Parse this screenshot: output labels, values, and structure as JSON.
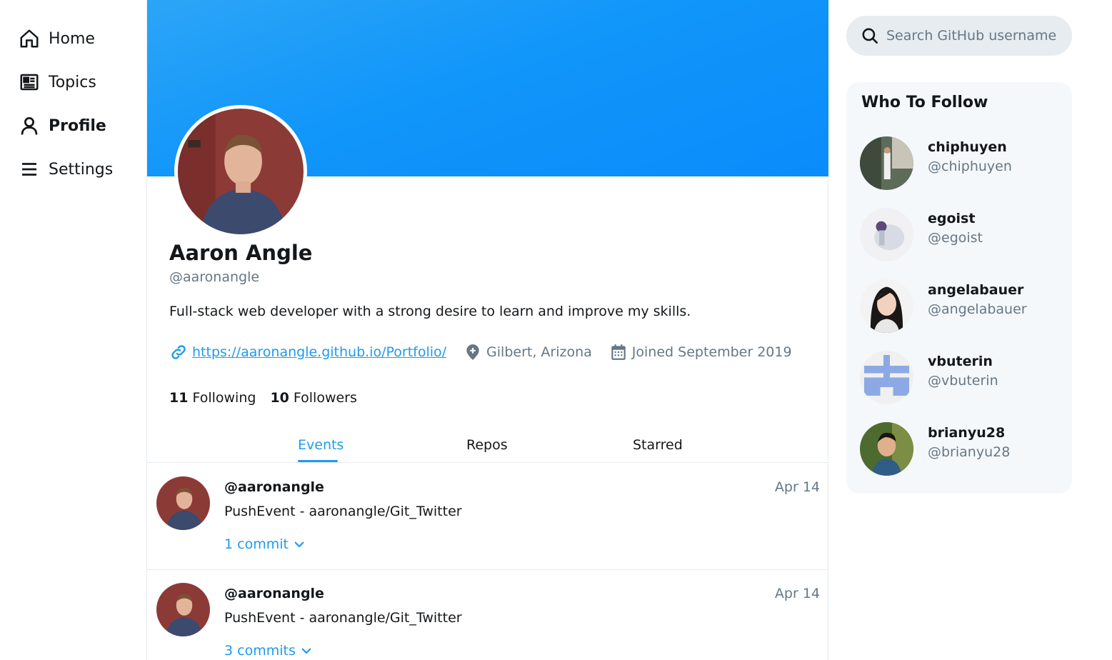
{
  "nav": {
    "items": [
      {
        "label": "Home",
        "icon": "home-icon"
      },
      {
        "label": "Topics",
        "icon": "newspaper-icon"
      },
      {
        "label": "Profile",
        "icon": "user-icon",
        "active": true
      },
      {
        "label": "Settings",
        "icon": "menu-icon"
      }
    ]
  },
  "profile": {
    "name": "Aaron Angle",
    "handle": "@aaronangle",
    "bio": "Full-stack web developer with a strong desire to learn and improve my skills.",
    "website": "https://aaronangle.github.io/Portfolio/",
    "location": "Gilbert, Arizona",
    "joined": "Joined September 2019",
    "following_count": "11",
    "following_label": "Following",
    "followers_count": "10",
    "followers_label": "Followers"
  },
  "tabs": [
    {
      "label": "Events",
      "active": true
    },
    {
      "label": "Repos"
    },
    {
      "label": "Starred"
    }
  ],
  "events": [
    {
      "user": "@aaronangle",
      "date": "Apr 14",
      "desc": "PushEvent - aaronangle/Git_Twitter",
      "commits": "1 commit"
    },
    {
      "user": "@aaronangle",
      "date": "Apr 14",
      "desc": "PushEvent - aaronangle/Git_Twitter",
      "commits": "3 commits"
    }
  ],
  "search": {
    "placeholder": "Search GitHub username"
  },
  "who_to_follow": {
    "title": "Who To Follow",
    "users": [
      {
        "name": "chiphuyen",
        "handle": "@chiphuyen"
      },
      {
        "name": "egoist",
        "handle": "@egoist"
      },
      {
        "name": "angelabauer",
        "handle": "@angelabauer"
      },
      {
        "name": "vbuterin",
        "handle": "@vbuterin"
      },
      {
        "name": "brianyu28",
        "handle": "@brianyu28"
      }
    ]
  },
  "colors": {
    "accent": "#1d9bf0",
    "banner": "#1196fa",
    "muted": "#657786"
  }
}
